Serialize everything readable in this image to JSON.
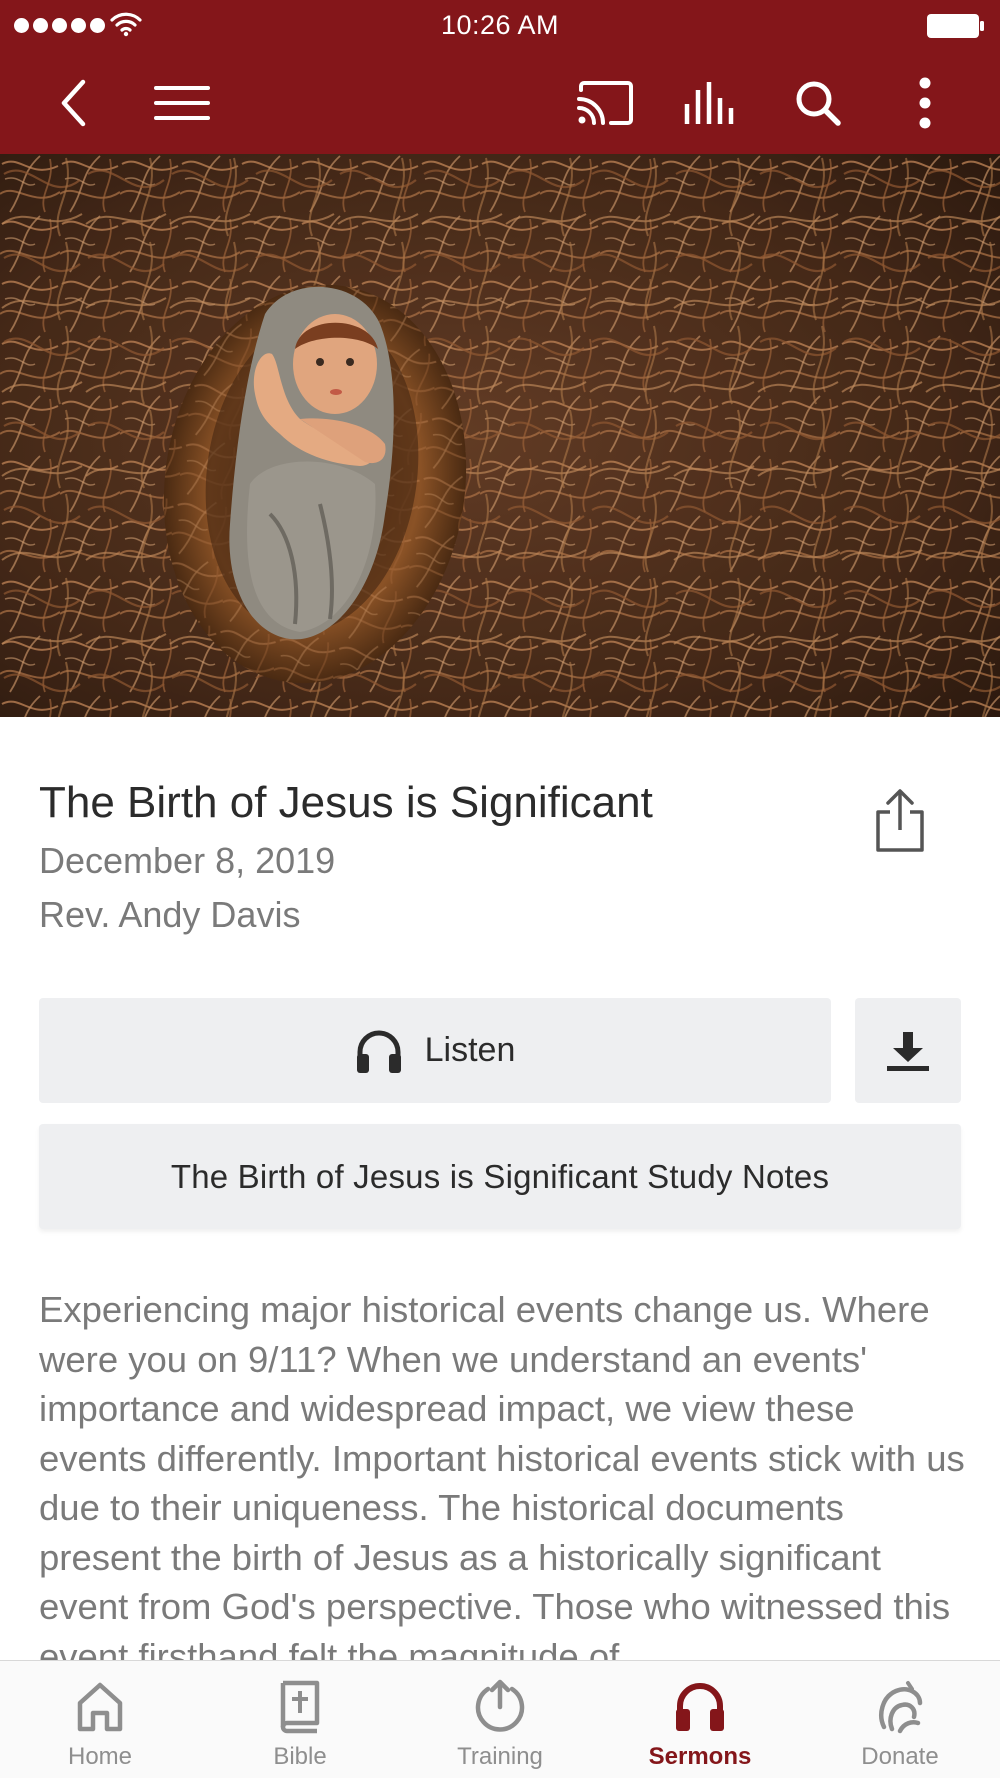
{
  "status_bar": {
    "time": "10:26 AM"
  },
  "nav": {
    "icons": [
      "back-icon",
      "menu-icon",
      "cast-icon",
      "equalizer-icon",
      "search-icon",
      "more-vertical-icon"
    ]
  },
  "hero": {
    "image": "nativity-baby-jesus-in-manger-photo"
  },
  "sermon": {
    "title": "The Birth of Jesus is Significant",
    "date": "December 8, 2019",
    "speaker": "Rev. Andy Davis"
  },
  "actions": {
    "listen_label": "Listen",
    "study_notes_label": "The Birth of Jesus is Significant Study Notes"
  },
  "description": "Experiencing major historical events change us. Where were you on 9/11? When we understand an events' importance and widespread impact, we view these events differently. Important historical events stick with us due to their uniqueness. The historical documents present the birth of Jesus as a historically significant event from God's perspective. Those who witnessed this event firsthand felt the magnitude of",
  "tabs": [
    {
      "label": "Home",
      "icon": "home-icon"
    },
    {
      "label": "Bible",
      "icon": "bible-icon"
    },
    {
      "label": "Training",
      "icon": "training-icon"
    },
    {
      "label": "Sermons",
      "icon": "headphones-icon",
      "active": true
    },
    {
      "label": "Donate",
      "icon": "donate-icon"
    }
  ],
  "colors": {
    "brand": "#84161a",
    "button_bg": "#eeeff1",
    "muted_text": "#7a7a7a",
    "tab_inactive": "#8e8e8e"
  }
}
